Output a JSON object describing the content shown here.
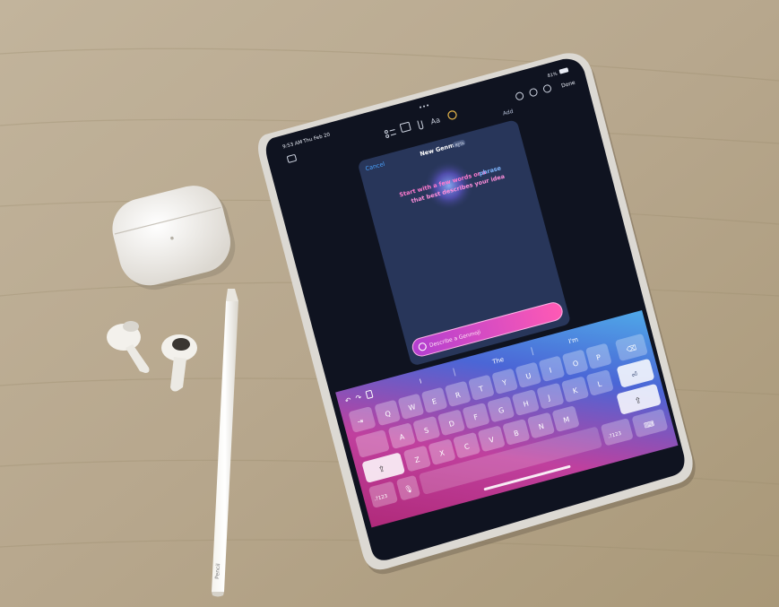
{
  "status_bar": {
    "time": "9:53 AM",
    "date": "Thu Feb 20",
    "battery": "81%"
  },
  "notes_toolbar": {
    "dots": "•••",
    "format_label": "Aa",
    "done_label": "Done"
  },
  "dialog": {
    "title": "New Genmoji",
    "badge": "BETA",
    "cancel_label": "Cancel",
    "add_label": "Add",
    "prompt_line1_a": "Start with a few words or a",
    "prompt_line1_b": "phrase",
    "prompt_line2": "that best describes your idea",
    "input_placeholder": "Describe a Genmoji"
  },
  "keyboard": {
    "suggestions": [
      "I",
      "The",
      "I'm"
    ],
    "row1": [
      "Q",
      "W",
      "E",
      "R",
      "T",
      "Y",
      "U",
      "I",
      "O",
      "P"
    ],
    "row2": [
      "A",
      "S",
      "D",
      "F",
      "G",
      "H",
      "J",
      "K",
      "L"
    ],
    "row3": [
      "Z",
      "X",
      "C",
      "V",
      "B",
      "N",
      "M"
    ],
    "numbers_label": ".?123",
    "numbers_label_right": ".?123"
  },
  "pencil_brand": "Pencil",
  "colors": {
    "table": "#b8a990",
    "ipad_frame": "#d9d6d0",
    "screen": "#10131f",
    "dialog": "#283657",
    "accent_blue": "#4aa3ff",
    "genmoji_pink": "#e040c8"
  }
}
